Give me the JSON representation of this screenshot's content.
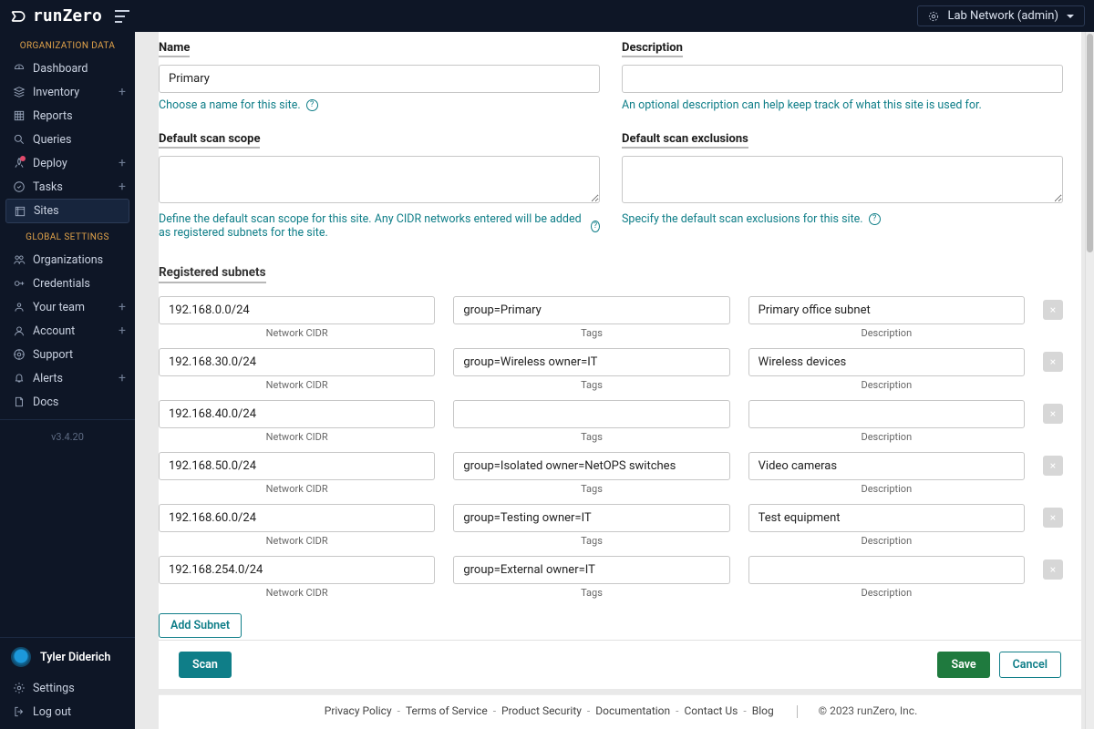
{
  "brand": "runZero",
  "org_selector": "Lab Network (admin)",
  "sidebar": {
    "section1": "ORGANIZATION DATA",
    "section2": "GLOBAL SETTINGS",
    "items_org": [
      {
        "label": "Dashboard",
        "plus": false
      },
      {
        "label": "Inventory",
        "plus": true
      },
      {
        "label": "Reports",
        "plus": false
      },
      {
        "label": "Queries",
        "plus": false
      },
      {
        "label": "Deploy",
        "plus": true,
        "dot": true
      },
      {
        "label": "Tasks",
        "plus": true
      },
      {
        "label": "Sites",
        "plus": false,
        "active": true
      }
    ],
    "items_global": [
      {
        "label": "Organizations",
        "plus": false
      },
      {
        "label": "Credentials",
        "plus": false
      },
      {
        "label": "Your team",
        "plus": true
      },
      {
        "label": "Account",
        "plus": true
      },
      {
        "label": "Support",
        "plus": false
      },
      {
        "label": "Alerts",
        "plus": true
      },
      {
        "label": "Docs",
        "plus": false
      }
    ],
    "version": "v3.4.20",
    "bottom": [
      {
        "label": "Settings"
      },
      {
        "label": "Log out"
      }
    ]
  },
  "user": "Tyler Diderich",
  "form": {
    "name": {
      "label": "Name",
      "value": "Primary",
      "helper": "Choose a name for this site."
    },
    "description": {
      "label": "Description",
      "value": "",
      "helper": "An optional description can help keep track of what this site is used for."
    },
    "scope": {
      "label": "Default scan scope",
      "value": "",
      "helper": "Define the default scan scope for this site. Any CIDR networks entered will be added as registered subnets for the site."
    },
    "exclusions": {
      "label": "Default scan exclusions",
      "value": "",
      "helper": "Specify the default scan exclusions for this site."
    }
  },
  "subnets": {
    "heading": "Registered subnets",
    "col_cidr": "Network CIDR",
    "col_tags": "Tags",
    "col_desc": "Description",
    "add_label": "Add Subnet",
    "rows": [
      {
        "cidr": "192.168.0.0/24",
        "tags": "group=Primary",
        "desc": "Primary office subnet"
      },
      {
        "cidr": "192.168.30.0/24",
        "tags": "group=Wireless owner=IT",
        "desc": "Wireless devices"
      },
      {
        "cidr": "192.168.40.0/24",
        "tags": "",
        "desc": ""
      },
      {
        "cidr": "192.168.50.0/24",
        "tags": "group=Isolated owner=NetOPS switches",
        "desc": "Video cameras"
      },
      {
        "cidr": "192.168.60.0/24",
        "tags": "group=Testing owner=IT",
        "desc": "Test equipment"
      },
      {
        "cidr": "192.168.254.0/24",
        "tags": "group=External owner=IT",
        "desc": ""
      }
    ]
  },
  "actions": {
    "scan": "Scan",
    "save": "Save",
    "cancel": "Cancel"
  },
  "footer": {
    "links": [
      "Privacy Policy",
      "Terms of Service",
      "Product Security",
      "Documentation",
      "Contact Us",
      "Blog"
    ],
    "copyright": "© 2023 runZero, Inc."
  }
}
